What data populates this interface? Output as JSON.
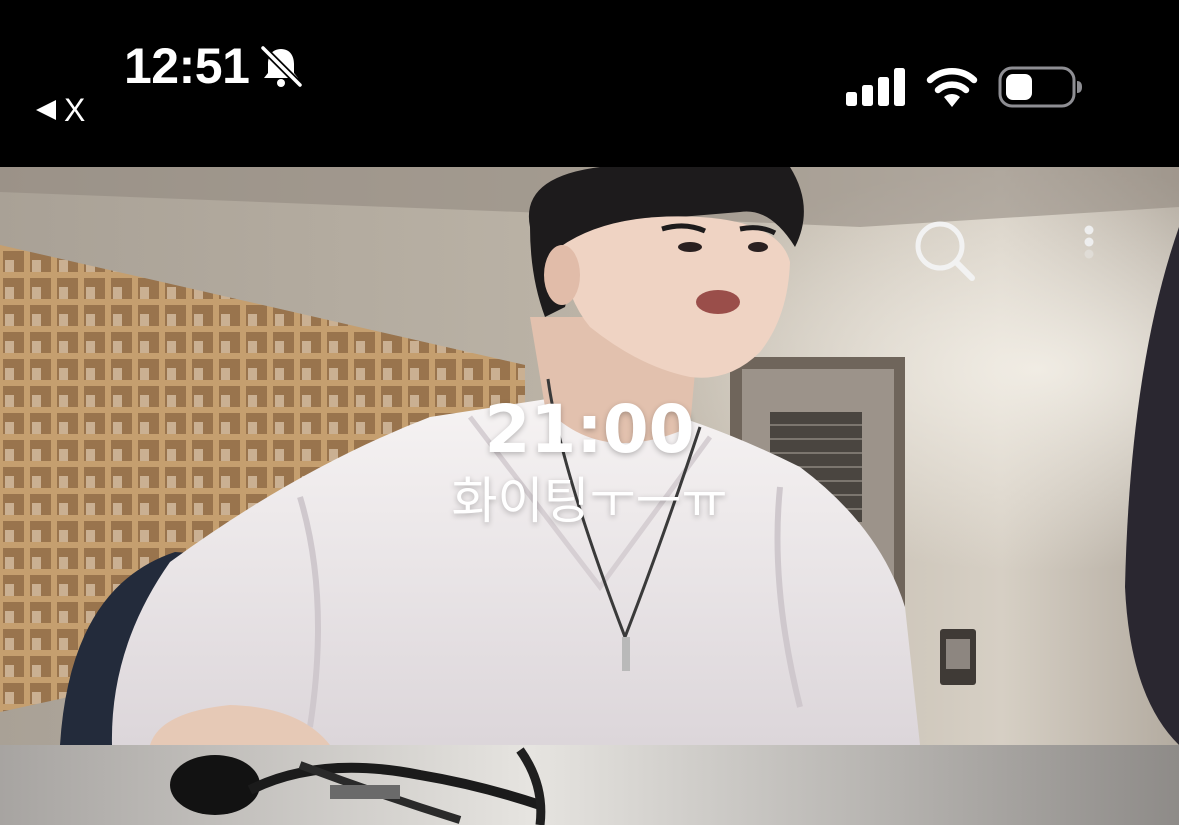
{
  "status_bar": {
    "time": "12:51",
    "back_label": "X",
    "icons": [
      "bell-off-icon",
      "cellular-signal-icon",
      "wifi-icon",
      "battery-icon"
    ]
  },
  "video": {
    "overlay_time": "21:00",
    "overlay_caption": "화이팅ㅜㅡㅠ",
    "controls": [
      "search-icon",
      "more-vertical-icon"
    ]
  },
  "colors": {
    "status_bar_bg": "#000000",
    "overlay_text": "#ffffff"
  }
}
